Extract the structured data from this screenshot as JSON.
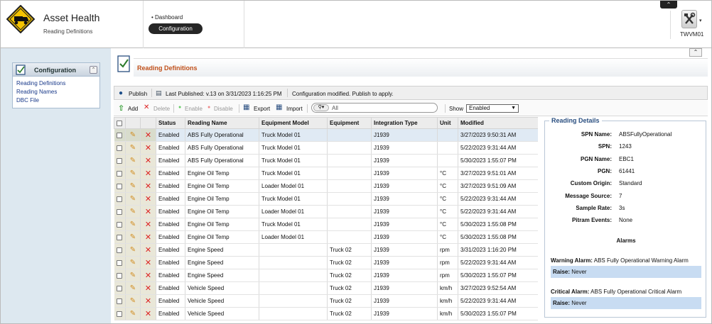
{
  "header": {
    "app_title": "Asset Health",
    "app_subtitle": "Reading Definitions",
    "nav": {
      "dashboard": "Dashboard",
      "configuration": "Configuration"
    },
    "user": "TWVM01"
  },
  "sidebar": {
    "panel_title": "Configuration",
    "links": [
      "Reading Definitions",
      "Reading Names",
      "DBC File"
    ]
  },
  "main": {
    "page_title": "Reading Definitions",
    "publish_bar": {
      "publish": "Publish",
      "last_published": "Last Published: v.13 on 3/31/2023 1:16:25 PM",
      "status": "Configuration modified. Publish to apply."
    },
    "toolbar": {
      "add": "Add",
      "delete": "Delete",
      "enable": "Enable",
      "disable": "Disable",
      "export": "Export",
      "import": "Import",
      "search_value": "All",
      "show_label": "Show",
      "show_value": "Enabled"
    },
    "columns": [
      "Status",
      "Reading Name",
      "Equipment Model",
      "Equipment",
      "Integration Type",
      "Unit",
      "Modified"
    ],
    "rows": [
      [
        "Enabled",
        "ABS Fully Operational",
        "Truck Model 01",
        "",
        "J1939",
        "",
        "3/27/2023 9:50:31 AM"
      ],
      [
        "Enabled",
        "ABS Fully Operational",
        "Truck Model 01",
        "",
        "J1939",
        "",
        "5/22/2023 9:31:44 AM"
      ],
      [
        "Enabled",
        "ABS Fully Operational",
        "Truck Model 01",
        "",
        "J1939",
        "",
        "5/30/2023 1:55:07 PM"
      ],
      [
        "Enabled",
        "Engine Oil Temp",
        "Truck Model 01",
        "",
        "J1939",
        "°C",
        "3/27/2023 9:51:01 AM"
      ],
      [
        "Enabled",
        "Engine Oil Temp",
        "Loader Model 01",
        "",
        "J1939",
        "°C",
        "3/27/2023 9:51:09 AM"
      ],
      [
        "Enabled",
        "Engine Oil Temp",
        "Truck Model 01",
        "",
        "J1939",
        "°C",
        "5/22/2023 9:31:44 AM"
      ],
      [
        "Enabled",
        "Engine Oil Temp",
        "Loader Model 01",
        "",
        "J1939",
        "°C",
        "5/22/2023 9:31:44 AM"
      ],
      [
        "Enabled",
        "Engine Oil Temp",
        "Truck Model 01",
        "",
        "J1939",
        "°C",
        "5/30/2023 1:55:08 PM"
      ],
      [
        "Enabled",
        "Engine Oil Temp",
        "Loader Model 01",
        "",
        "J1939",
        "°C",
        "5/30/2023 1:55:08 PM"
      ],
      [
        "Enabled",
        "Engine Speed",
        "",
        "Truck 02",
        "J1939",
        "rpm",
        "3/31/2023 1:16:20 PM"
      ],
      [
        "Enabled",
        "Engine Speed",
        "",
        "Truck 02",
        "J1939",
        "rpm",
        "5/22/2023 9:31:44 AM"
      ],
      [
        "Enabled",
        "Engine Speed",
        "",
        "Truck 02",
        "J1939",
        "rpm",
        "5/30/2023 1:55:07 PM"
      ],
      [
        "Enabled",
        "Vehicle Speed",
        "",
        "Truck 02",
        "J1939",
        "km/h",
        "3/27/2023 9:52:54 AM"
      ],
      [
        "Enabled",
        "Vehicle Speed",
        "",
        "Truck 02",
        "J1939",
        "km/h",
        "5/22/2023 9:31:44 AM"
      ],
      [
        "Enabled",
        "Vehicle Speed",
        "",
        "Truck 02",
        "J1939",
        "km/h",
        "5/30/2023 1:55:07 PM"
      ]
    ],
    "selected_row": 0
  },
  "details": {
    "title": "Reading Details",
    "fields": [
      {
        "label": "SPN Name:",
        "value": "ABSFullyOperational"
      },
      {
        "label": "SPN:",
        "value": "1243"
      },
      {
        "label": "PGN Name:",
        "value": "EBC1"
      },
      {
        "label": "PGN:",
        "value": "61441"
      },
      {
        "label": "Custom Origin:",
        "value": "Standard"
      },
      {
        "label": "Message Source:",
        "value": "7"
      },
      {
        "label": "Sample Rate:",
        "value": "3s"
      },
      {
        "label": "Pitram Events:",
        "value": "None"
      }
    ],
    "alarms_title": "Alarms",
    "warning": {
      "label": "Warning Alarm:",
      "value": "ABS Fully Operational Warning Alarm",
      "raise_label": "Raise:",
      "raise_value": "Never"
    },
    "critical": {
      "label": "Critical Alarm:",
      "value": "ABS Fully Operational Critical Alarm",
      "raise_label": "Raise:",
      "raise_value": "Never"
    }
  }
}
